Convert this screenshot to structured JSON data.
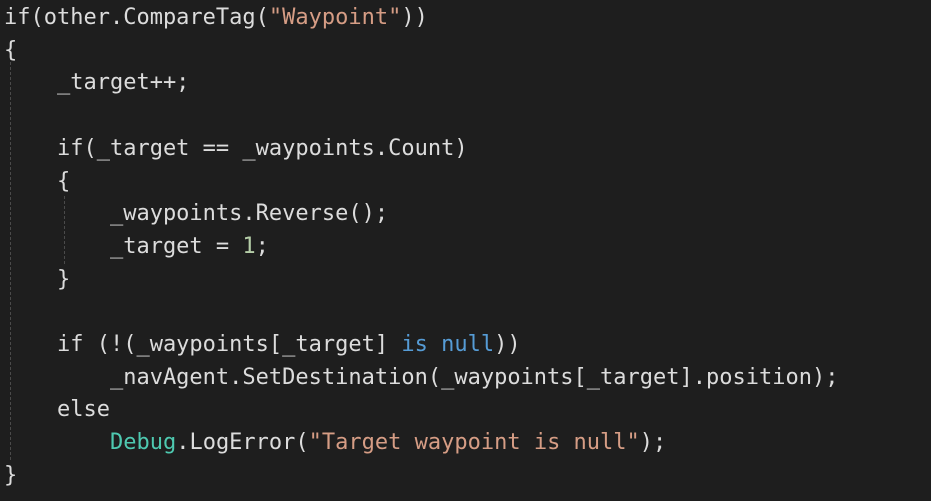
{
  "editor": {
    "colors": {
      "background": "#1e1e1e",
      "plain": "#dcdcdc",
      "keyword": "#569cd6",
      "string": "#d69d85",
      "type": "#4ec9b0",
      "number": "#b5cea8",
      "indent_guide": "#4a4a4a"
    },
    "lines": [
      [
        {
          "t": "if(other.CompareTag(",
          "c": "plain"
        },
        {
          "t": "\"Waypoint\"",
          "c": "str"
        },
        {
          "t": "))",
          "c": "plain"
        }
      ],
      [
        {
          "t": "{",
          "c": "plain"
        }
      ],
      [
        {
          "t": "    _target++;",
          "c": "plain"
        }
      ],
      [],
      [
        {
          "t": "    if(_target == _waypoints.Count)",
          "c": "plain"
        }
      ],
      [
        {
          "t": "    {",
          "c": "plain"
        }
      ],
      [
        {
          "t": "        _waypoints.Reverse();",
          "c": "plain"
        }
      ],
      [
        {
          "t": "        _target = ",
          "c": "plain"
        },
        {
          "t": "1",
          "c": "num"
        },
        {
          "t": ";",
          "c": "plain"
        }
      ],
      [
        {
          "t": "    }",
          "c": "plain"
        }
      ],
      [],
      [
        {
          "t": "    if (!(_waypoints[_target] ",
          "c": "plain"
        },
        {
          "t": "is",
          "c": "kw"
        },
        {
          "t": " ",
          "c": "plain"
        },
        {
          "t": "null",
          "c": "kw"
        },
        {
          "t": "))",
          "c": "plain"
        }
      ],
      [
        {
          "t": "        _navAgent.SetDestination(_waypoints[_target].position);",
          "c": "plain"
        }
      ],
      [
        {
          "t": "    else",
          "c": "plain"
        }
      ],
      [
        {
          "t": "        ",
          "c": "plain"
        },
        {
          "t": "Debug",
          "c": "type"
        },
        {
          "t": ".LogError(",
          "c": "plain"
        },
        {
          "t": "\"Target waypoint is null\"",
          "c": "str"
        },
        {
          "t": ");",
          "c": "plain"
        }
      ],
      [
        {
          "t": "}",
          "c": "plain"
        }
      ]
    ]
  }
}
